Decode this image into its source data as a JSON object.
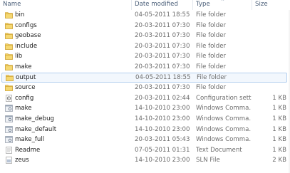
{
  "columns": {
    "name": "Name",
    "date_modified": "Date modified",
    "type": "Type",
    "size": "Size",
    "sort_indicator": "^"
  },
  "files": [
    {
      "name": "bin",
      "date": "04-05-2011 18:55",
      "type": "File folder",
      "size": "",
      "icon": "folder-icon"
    },
    {
      "name": "configs",
      "date": "20-03-2011 07:30",
      "type": "File folder",
      "size": "",
      "icon": "folder-icon"
    },
    {
      "name": "geobase",
      "date": "20-03-2011 07:30",
      "type": "File folder",
      "size": "",
      "icon": "folder-icon"
    },
    {
      "name": "include",
      "date": "20-03-2011 07:30",
      "type": "File folder",
      "size": "",
      "icon": "folder-icon"
    },
    {
      "name": "lib",
      "date": "20-03-2011 07:30",
      "type": "File folder",
      "size": "",
      "icon": "folder-icon"
    },
    {
      "name": "make",
      "date": "20-03-2011 07:30",
      "type": "File folder",
      "size": "",
      "icon": "folder-icon"
    },
    {
      "name": "output",
      "date": "04-05-2011 18:55",
      "type": "File folder",
      "size": "",
      "icon": "folder-icon",
      "selected": true
    },
    {
      "name": "source",
      "date": "20-03-2011 07:30",
      "type": "File folder",
      "size": "",
      "icon": "folder-icon"
    },
    {
      "name": "config",
      "date": "20-03-2011 02:44",
      "type": "Configuration sett...",
      "size": "1 KB",
      "icon": "config-file-icon"
    },
    {
      "name": "make",
      "date": "14-10-2010 23:00",
      "type": "Windows Comma...",
      "size": "1 KB",
      "icon": "batch-file-icon"
    },
    {
      "name": "make_debug",
      "date": "14-10-2010 23:00",
      "type": "Windows Comma...",
      "size": "1 KB",
      "icon": "batch-file-icon"
    },
    {
      "name": "make_default",
      "date": "14-10-2010 23:00",
      "type": "Windows Comma...",
      "size": "1 KB",
      "icon": "batch-file-icon"
    },
    {
      "name": "make_full",
      "date": "20-03-2011 05:43",
      "type": "Windows Comma...",
      "size": "1 KB",
      "icon": "batch-file-icon"
    },
    {
      "name": "Readme",
      "date": "07-05-2011 01:31",
      "type": "Text Document",
      "size": "1 KB",
      "icon": "text-document-icon"
    },
    {
      "name": "zeus",
      "date": "14-10-2010 23:00",
      "type": "SLN File",
      "size": "2 KB",
      "icon": "sln-file-icon"
    }
  ],
  "colors": {
    "folder": "#e8c04a",
    "selection_bg": "#f2f7fd",
    "selection_border": "#b4d0ef",
    "header_text": "#4c607a"
  }
}
